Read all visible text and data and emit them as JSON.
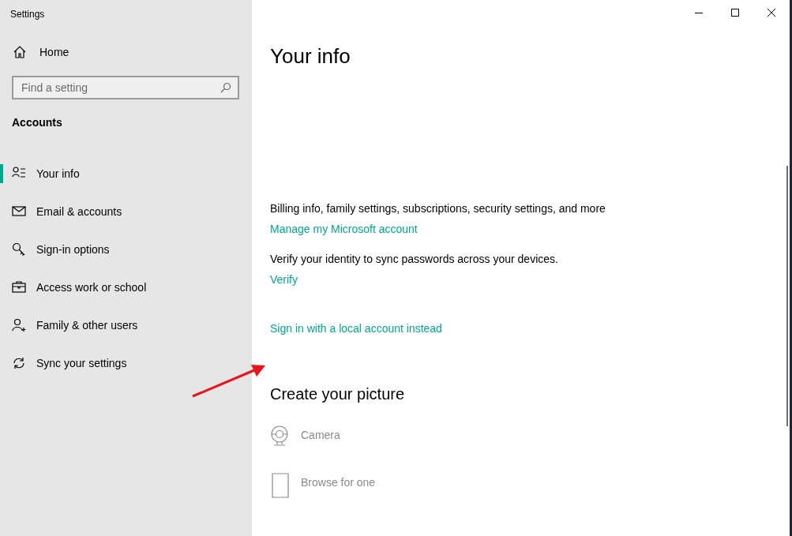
{
  "window": {
    "title": "Settings"
  },
  "sidebar": {
    "home": "Home",
    "search": {
      "placeholder": "Find a setting"
    },
    "section": "Accounts",
    "items": [
      {
        "label": "Your info",
        "kind": "profile",
        "selected": true
      },
      {
        "label": "Email & accounts",
        "kind": "email",
        "selected": false
      },
      {
        "label": "Sign-in options",
        "kind": "signin",
        "selected": false
      },
      {
        "label": "Access work or school",
        "kind": "work",
        "selected": false
      },
      {
        "label": "Family & other users",
        "kind": "family",
        "selected": false
      },
      {
        "label": "Sync your settings",
        "kind": "sync",
        "selected": false
      }
    ]
  },
  "content": {
    "title": "Your info",
    "blocks": [
      {
        "kind": "text",
        "text": "Billing info, family settings, subscriptions, security settings, and more"
      },
      {
        "kind": "link",
        "text": "Manage my Microsoft account"
      },
      {
        "kind": "text",
        "text": "Verify your identity to sync passwords across your devices."
      },
      {
        "kind": "link",
        "text": "Verify"
      },
      {
        "kind": "link",
        "text": "Sign in with a local account instead"
      }
    ],
    "picture_heading": "Create your picture",
    "picture_options": [
      {
        "label": "Camera",
        "kind": "camera",
        "disabled": true
      },
      {
        "label": "Browse for one",
        "kind": "browse",
        "disabled": true
      }
    ]
  }
}
